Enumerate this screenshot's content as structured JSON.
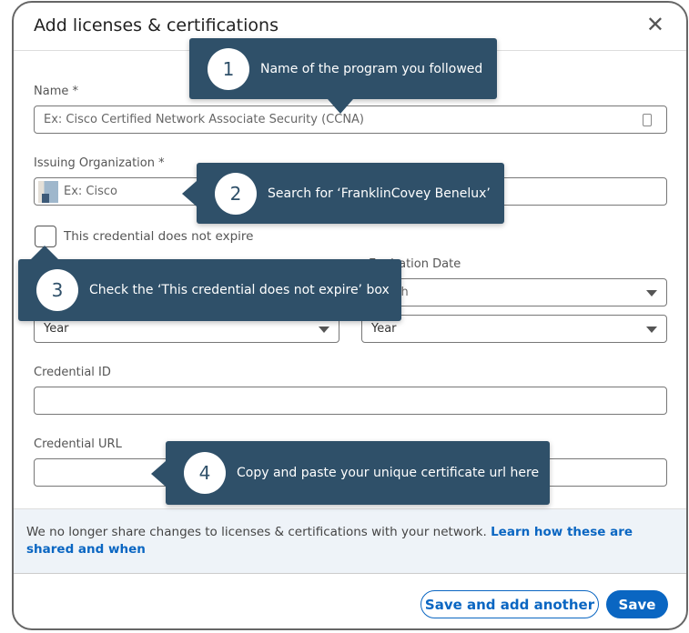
{
  "dialog": {
    "title": "Add licenses & certifications"
  },
  "fields": {
    "name_label": "Name *",
    "name_placeholder": "Ex: Cisco Certified Network Associate Security (CCNA)",
    "org_label": "Issuing Organization *",
    "org_placeholder": "Ex: Cisco",
    "no_expire_label": "This credential does not expire",
    "exp_label": "Expiration Date",
    "exp_month": "Month",
    "issue_year": "Year",
    "exp_year": "Year",
    "cred_id_label": "Credential ID",
    "cred_url_label": "Credential URL"
  },
  "tooltips": [
    {
      "num": "1",
      "text": "Name of the program you followed"
    },
    {
      "num": "2",
      "text": "Search for ‘FranklinCovey Benelux’"
    },
    {
      "num": "3",
      "text": "Check the ‘This credential does not expire’ box"
    },
    {
      "num": "4",
      "text": "Copy and paste your unique certificate url here"
    }
  ],
  "notice": {
    "text": "We no longer share changes to licenses & certifications with your network. ",
    "link": "Learn how these are shared and when"
  },
  "buttons": {
    "save_another": "Save and add another",
    "save": "Save"
  },
  "colors": {
    "tooltip": "#2f5069",
    "primary": "#0a66c2",
    "notice_bg": "#eef3f8"
  }
}
